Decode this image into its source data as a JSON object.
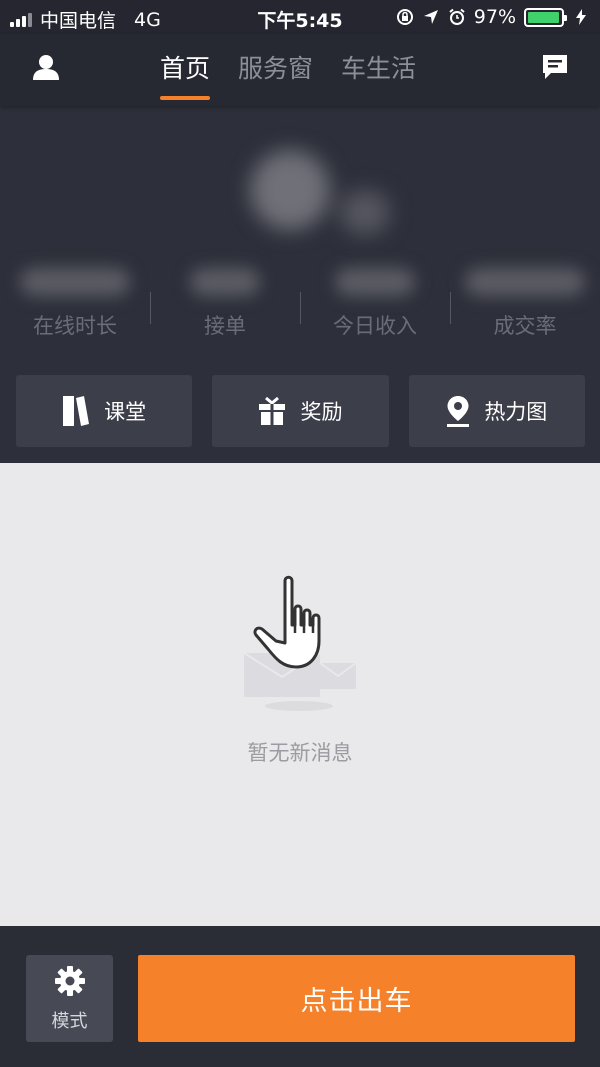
{
  "status_bar": {
    "carrier": "中国电信",
    "network": "4G",
    "time": "下午5:45",
    "battery_text": "97%",
    "battery_level": 0.97,
    "battery_color": "#3fd26b",
    "icons": [
      "signal-icon",
      "rotation-lock-icon",
      "location-arrow-icon",
      "alarm-icon",
      "battery-icon"
    ]
  },
  "nav": {
    "tabs": [
      {
        "label": "首页",
        "active": true
      },
      {
        "label": "服务窗",
        "active": false
      },
      {
        "label": "车生活",
        "active": false
      }
    ],
    "left_icon": "user-icon",
    "right_icon": "message-icon",
    "accent_color": "#f5812a"
  },
  "stats": [
    {
      "label": "在线时长"
    },
    {
      "label": "接单"
    },
    {
      "label": "今日收入"
    },
    {
      "label": "成交率"
    }
  ],
  "quick_actions": [
    {
      "label": "课堂",
      "icon": "book-icon"
    },
    {
      "label": "奖励",
      "icon": "gift-icon"
    },
    {
      "label": "热力图",
      "icon": "map-pin-icon"
    }
  ],
  "content": {
    "empty_message": "暂无新消息"
  },
  "bottom": {
    "mode_label": "模式",
    "mode_icon": "gear-icon",
    "start_label": "点击出车",
    "start_color": "#f5812a"
  }
}
